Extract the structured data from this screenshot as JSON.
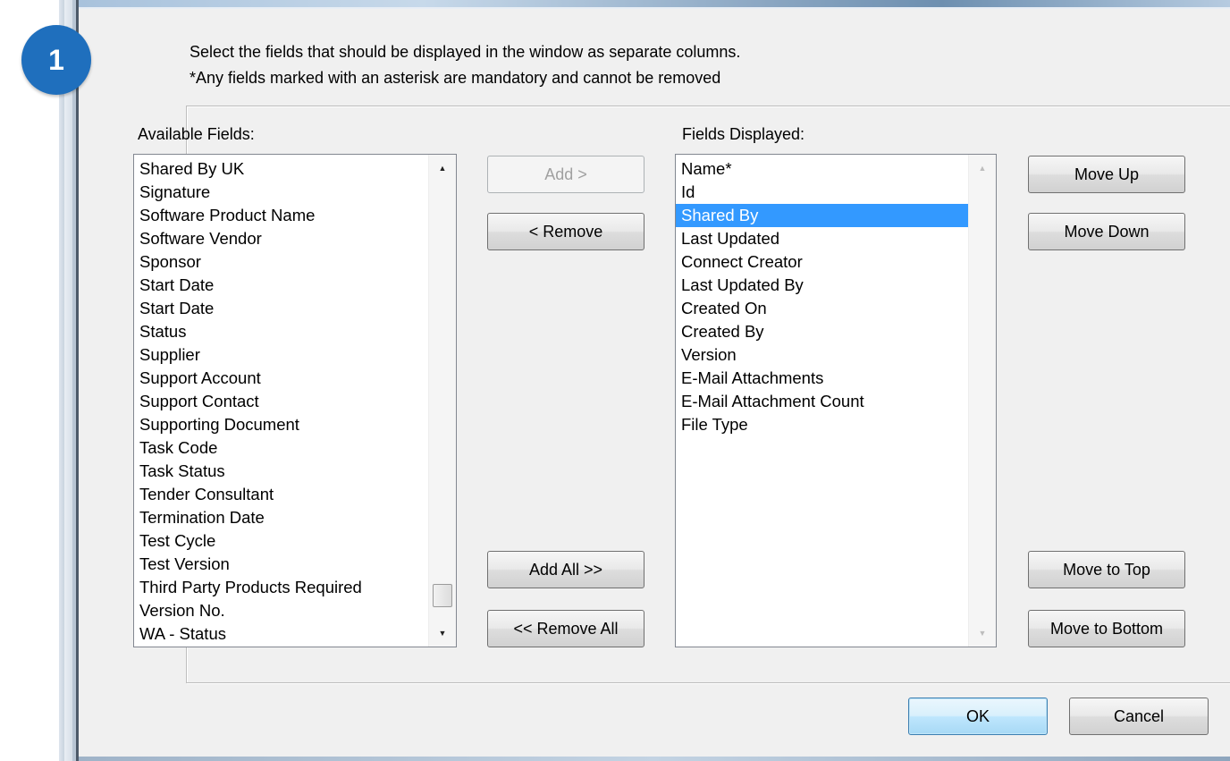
{
  "step_badge": "1",
  "instructions": {
    "line1": "Select the fields that should be displayed in the window as separate columns.",
    "line2": "*Any fields marked with an asterisk are mandatory and cannot be removed"
  },
  "available": {
    "label": "Available Fields:",
    "items": [
      "Shared By UK",
      "Signature",
      "Software Product Name",
      "Software Vendor",
      "Sponsor",
      "Start Date",
      "Start Date",
      "Status",
      "Supplier",
      "Support Account",
      "Support Contact",
      "Supporting Document",
      "Task Code",
      "Task Status",
      "Tender Consultant",
      "Termination Date",
      "Test Cycle",
      "Test Version",
      "Third Party Products Required",
      "Version No.",
      "WA - Status"
    ]
  },
  "displayed": {
    "label": "Fields Displayed:",
    "items": [
      "Name*",
      "Id",
      "Shared By",
      "Last Updated",
      "Connect Creator",
      "Last Updated By",
      "Created On",
      "Created By",
      "Version",
      "E-Mail Attachments",
      "E-Mail Attachment Count",
      "File Type"
    ],
    "selected_item": "Shared By"
  },
  "transfer_buttons": {
    "add": "Add >",
    "remove": "< Remove",
    "add_all": "Add All  >>",
    "remove_all": "<< Remove All"
  },
  "order_buttons": {
    "move_up": "Move Up",
    "move_down": "Move Down",
    "move_to_top": "Move to Top",
    "move_to_bottom": "Move to Bottom"
  },
  "dialog_buttons": {
    "ok": "OK",
    "cancel": "Cancel"
  },
  "colors": {
    "badge": "#1f6fbd",
    "selection": "#3399ff",
    "dialog_background": "#f0f0f0"
  }
}
